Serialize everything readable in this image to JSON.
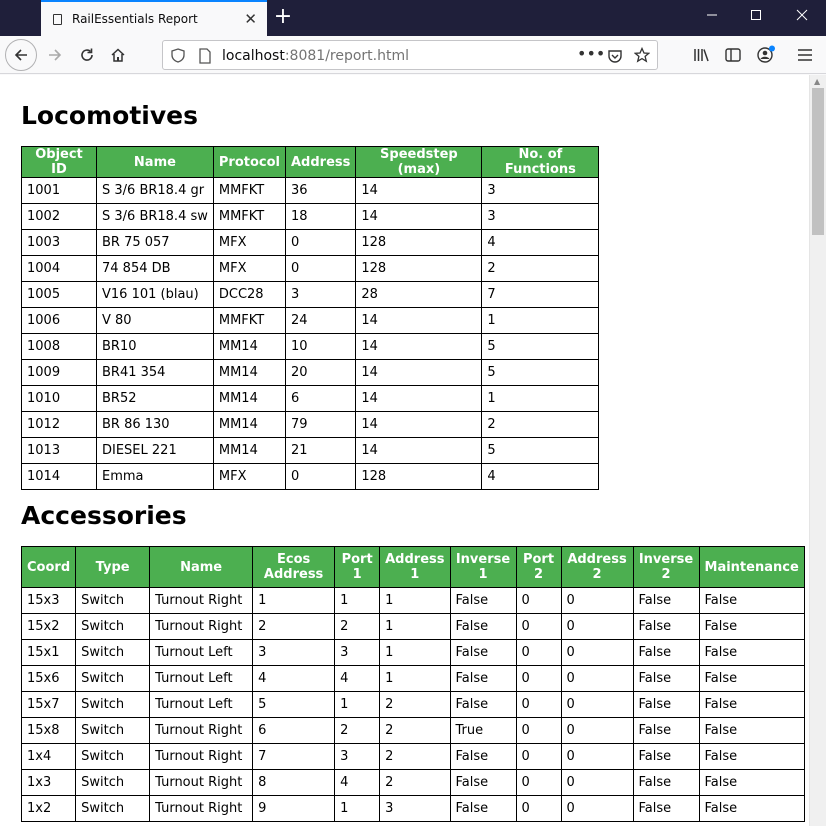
{
  "browser": {
    "tab_title": "RailEssentials Report",
    "url_host": "localhost",
    "url_rest": ":8081/report.html",
    "new_tab_label": "+",
    "window_controls": [
      "minimize-icon",
      "maximize-icon",
      "close-icon"
    ]
  },
  "locomotives": {
    "heading": "Locomotives",
    "columns": [
      "Object ID",
      "Name",
      "Protocol",
      "Address",
      "Speedstep (max)",
      "No. of Functions"
    ],
    "rows": [
      [
        "1001",
        "S 3/6 BR18.4 gr",
        "MMFKT",
        "36",
        "14",
        "3"
      ],
      [
        "1002",
        "S 3/6 BR18.4 sw",
        "MMFKT",
        "18",
        "14",
        "3"
      ],
      [
        "1003",
        "BR 75 057",
        "MFX",
        "0",
        "128",
        "4"
      ],
      [
        "1004",
        "74 854 DB",
        "MFX",
        "0",
        "128",
        "2"
      ],
      [
        "1005",
        "V16 101 (blau)",
        "DCC28",
        "3",
        "28",
        "7"
      ],
      [
        "1006",
        "V 80",
        "MMFKT",
        "24",
        "14",
        "1"
      ],
      [
        "1008",
        "BR10",
        "MM14",
        "10",
        "14",
        "5"
      ],
      [
        "1009",
        "BR41 354",
        "MM14",
        "20",
        "14",
        "5"
      ],
      [
        "1010",
        "BR52",
        "MM14",
        "6",
        "14",
        "1"
      ],
      [
        "1012",
        "BR 86 130",
        "MM14",
        "79",
        "14",
        "2"
      ],
      [
        "1013",
        "DIESEL 221",
        "MM14",
        "21",
        "14",
        "5"
      ],
      [
        "1014",
        "Emma",
        "MFX",
        "0",
        "128",
        "4"
      ]
    ]
  },
  "accessories": {
    "heading": "Accessories",
    "columns": [
      "Coord",
      "Type",
      "Name",
      "Ecos Address",
      "Port 1",
      "Address 1",
      "Inverse 1",
      "Port 2",
      "Address 2",
      "Inverse 2",
      "Maintenance"
    ],
    "rows": [
      [
        "15x3",
        "Switch",
        "Turnout Right",
        "1",
        "1",
        "1",
        "False",
        "0",
        "0",
        "False",
        "False"
      ],
      [
        "15x2",
        "Switch",
        "Turnout Right",
        "2",
        "2",
        "1",
        "False",
        "0",
        "0",
        "False",
        "False"
      ],
      [
        "15x1",
        "Switch",
        "Turnout Left",
        "3",
        "3",
        "1",
        "False",
        "0",
        "0",
        "False",
        "False"
      ],
      [
        "15x6",
        "Switch",
        "Turnout Left",
        "4",
        "4",
        "1",
        "False",
        "0",
        "0",
        "False",
        "False"
      ],
      [
        "15x7",
        "Switch",
        "Turnout Left",
        "5",
        "1",
        "2",
        "False",
        "0",
        "0",
        "False",
        "False"
      ],
      [
        "15x8",
        "Switch",
        "Turnout Right",
        "6",
        "2",
        "2",
        "True",
        "0",
        "0",
        "False",
        "False"
      ],
      [
        "1x4",
        "Switch",
        "Turnout Right",
        "7",
        "3",
        "2",
        "False",
        "0",
        "0",
        "False",
        "False"
      ],
      [
        "1x3",
        "Switch",
        "Turnout Right",
        "8",
        "4",
        "2",
        "False",
        "0",
        "0",
        "False",
        "False"
      ],
      [
        "1x2",
        "Switch",
        "Turnout Right",
        "9",
        "1",
        "3",
        "False",
        "0",
        "0",
        "False",
        "False"
      ]
    ]
  },
  "colors": {
    "header_bg": "#4caf50",
    "tabbar_bg": "#1f1f3a",
    "accent": "#0a84ff"
  }
}
